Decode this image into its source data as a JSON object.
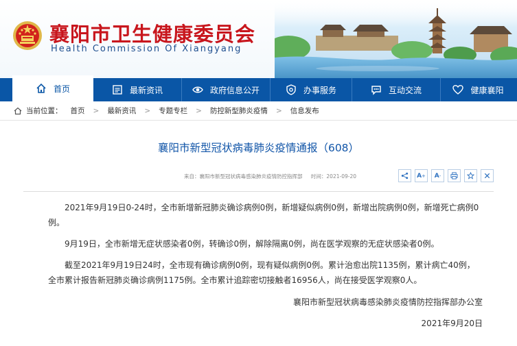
{
  "header": {
    "title": "襄阳市卫生健康委员会",
    "subtitle": "Health Commission Of Xiangyang"
  },
  "nav": {
    "items": [
      {
        "label": "首页",
        "icon": "home-icon"
      },
      {
        "label": "最新资讯",
        "icon": "news-icon"
      },
      {
        "label": "政府信息公开",
        "icon": "eye-icon"
      },
      {
        "label": "办事服务",
        "icon": "service-icon"
      },
      {
        "label": "互动交流",
        "icon": "chat-icon"
      },
      {
        "label": "健康襄阳",
        "icon": "heart-icon"
      }
    ]
  },
  "breadcrumb": {
    "prefix": "当前位置：",
    "items": [
      "首页",
      "最新资讯",
      "专题专栏",
      "防控新型肺炎疫情",
      "信息发布"
    ],
    "separator": ">"
  },
  "article": {
    "title": "襄阳市新型冠状病毒肺炎疫情通报（608）",
    "source": "来自：襄阳市新型冠状病毒感染肺炎疫情防控指挥部",
    "time": "时间：2021-09-20",
    "paragraphs": [
      "2021年9月19日0-24时，全市新增新冠肺炎确诊病例0例，新增疑似病例0例，新增出院病例0例，新增死亡病例0例。",
      "9月19日，全市新增无症状感染者0例，转确诊0例，解除隔离0例，尚在医学观察的无症状感染者0例。",
      "截至2021年9月19日24时，全市现有确诊病例0例，现有疑似病例0例。累计治愈出院1135例，累计病亡40例，全市累计报告新冠肺炎确诊病例1175例。全市累计追踪密切接触者16956人，尚在接受医学观察0人。"
    ],
    "signature": "襄阳市新型冠状病毒感染肺炎疫情防控指挥部办公室",
    "date": "2021年9月20日"
  },
  "tools": {
    "font_large": "A",
    "font_small": "A",
    "icons": [
      "share-icon",
      "font-larger-icon",
      "font-smaller-icon",
      "print-icon",
      "favorite-icon",
      "close-icon"
    ]
  },
  "colors": {
    "brand_red": "#c8161d",
    "nav_blue": "#0a56a6",
    "title_blue": "#1155a8"
  }
}
